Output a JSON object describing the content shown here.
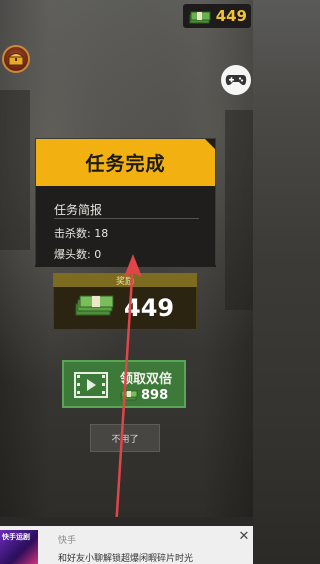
{
  "top_bar": {
    "currency_value": "449",
    "currency_icon": "cash-stack-icon",
    "chest_icon": "treasure-chest-icon",
    "gamepad_icon": "gamepad-icon"
  },
  "dialog": {
    "title": "任务完成",
    "report_title": "任务简报",
    "kills": "击杀数: 18",
    "headshots": "爆头数: 0",
    "reward_label": "奖励",
    "reward_value": "449"
  },
  "actions": {
    "double_label": "领取双倍",
    "double_value": "898",
    "skip_label": "不用了"
  },
  "ad_bar": {
    "thumb_text": "快手运剧",
    "app_name": "快手",
    "ad_text": "和好友小聊解锁超爆闲暇碎片时光",
    "close": "✕"
  },
  "colors": {
    "accent": "#f2b111",
    "green": "#3d7a3a",
    "arrow": "#e0454a"
  }
}
